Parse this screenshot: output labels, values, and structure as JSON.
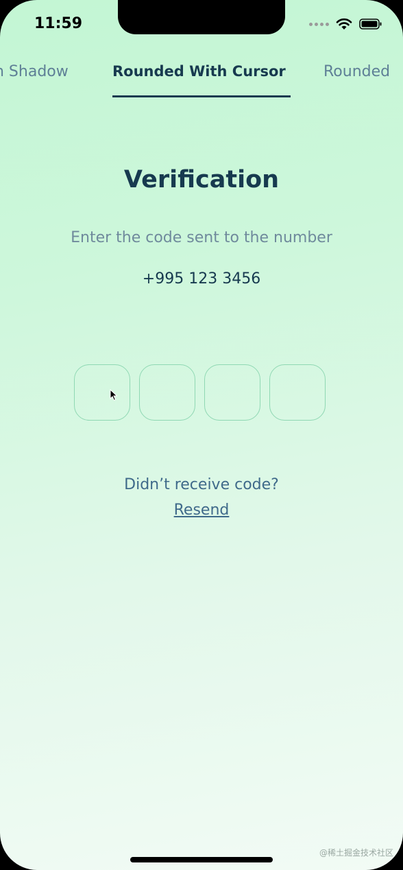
{
  "status_bar": {
    "time": "11:59",
    "icons": [
      "signal-dots-icon",
      "wifi-icon",
      "battery-icon"
    ]
  },
  "tabs": [
    {
      "label": "Rounded With Shadow",
      "visible_text": "n Shadow",
      "active": false
    },
    {
      "label": "Rounded With Cursor",
      "visible_text": "Rounded With Cursor",
      "active": true
    },
    {
      "label": "Rounded",
      "visible_text": "Rounded",
      "active": false
    }
  ],
  "main": {
    "title": "Verification",
    "subtitle": "Enter the code sent to the number",
    "phone_number": "+995 123 3456",
    "otp_boxes": [
      "",
      "",
      "",
      ""
    ],
    "resend_question": "Didn’t receive code?",
    "resend_label": "Resend"
  },
  "watermark": "@稀土掘金技术社区",
  "colors": {
    "primary": "#173a4f",
    "secondary_text": "#6f8a9c",
    "link": "#3f6a8a",
    "otp_border": "#8fd8b3",
    "background_top": "#c3f6d4",
    "background_bottom": "#f2fbf5"
  }
}
